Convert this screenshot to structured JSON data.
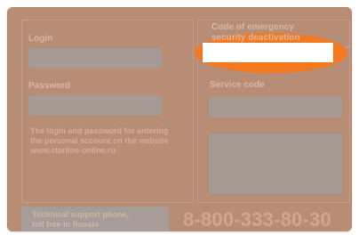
{
  "card": {
    "login_label": "Login",
    "password_label": "Password",
    "info_line1": "The login and password for entering",
    "info_line2": "the personal account on the website",
    "info_site": "www.starline-online.ru",
    "emergency_label_line1": "Code of emergency",
    "emergency_label_line2": "security deactivation",
    "service_code_label": "Service code",
    "support_line1": "Technical support phone,",
    "support_line2": "toll free in Russia",
    "phone": "8-800-333-80-30"
  },
  "colors": {
    "card_background": "#b88d75",
    "field": "#a69a95",
    "highlight": "#f27920",
    "highlight_box": "#ffffff"
  }
}
